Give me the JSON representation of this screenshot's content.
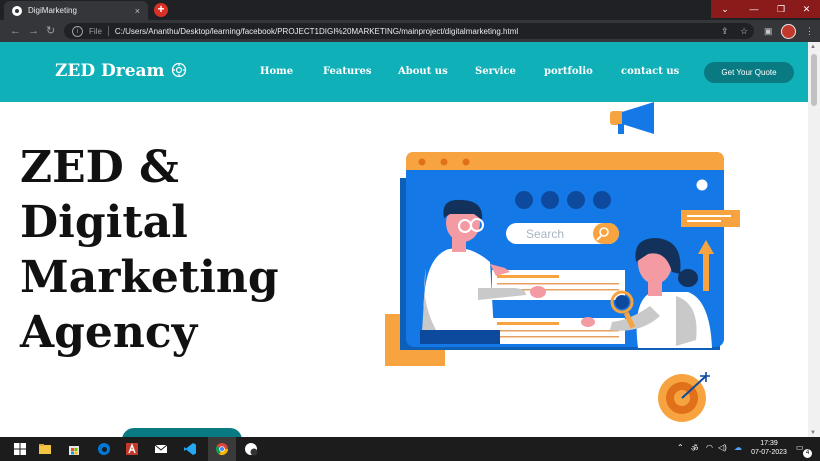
{
  "browser": {
    "tab_title": "DigiMarketing",
    "tab_close": "×",
    "new_tab": "+",
    "address_label": "File",
    "url": "C:/Users/Ananthu/Desktop/learning/facebook/PROJECT1DIGI%20MARKETING/mainproject/digitalmarketing.html",
    "window_controls": {
      "dropdown": "⌄",
      "minimize": "—",
      "maximize": "❐",
      "close": "✕"
    }
  },
  "site": {
    "logo": "ZED Dream",
    "nav": [
      "Home",
      "Features",
      "About us",
      "Service",
      "portfolio",
      "contact us"
    ],
    "cta_button": "Get Your Quote",
    "hero_title": [
      "ZED &",
      "Digital",
      "Marketing",
      "Agency"
    ],
    "illustration": {
      "search_placeholder": "Search"
    }
  },
  "taskbar": {
    "time": "17:39",
    "date": "07-07-2023",
    "notification_count": "4"
  },
  "colors": {
    "brand_teal": "#10b0b8",
    "button_teal": "#0a7a82",
    "illustration_blue": "#1479e6",
    "illustration_orange": "#f7a440"
  }
}
